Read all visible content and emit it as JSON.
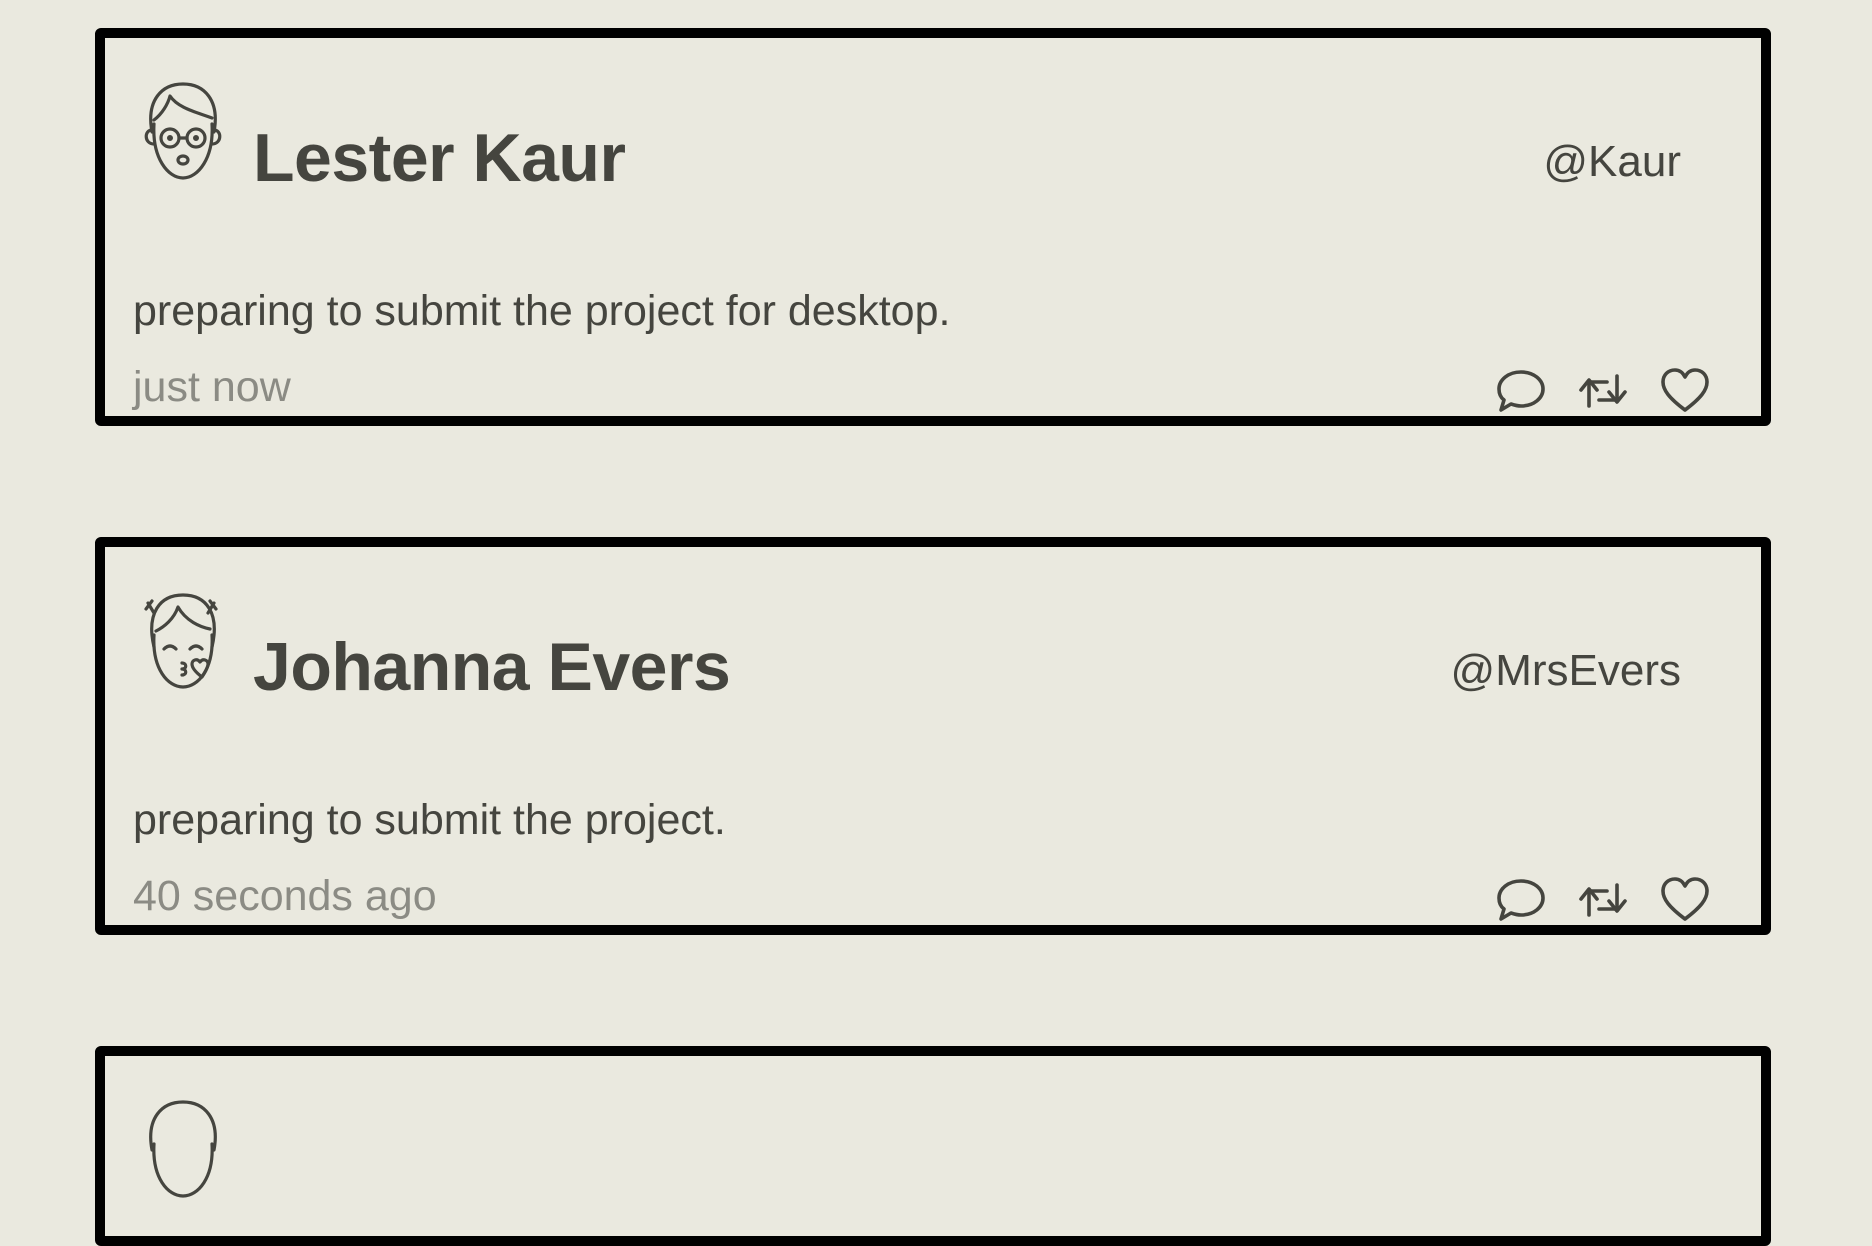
{
  "feed": {
    "posts": [
      {
        "display_name": "Lester Kaur",
        "handle": "@Kaur",
        "text": "preparing to submit the project for desktop.",
        "timestamp": "just now",
        "avatar_icon": "avatar-glasses-icon"
      },
      {
        "display_name": "Johanna Evers",
        "handle": "@MrsEvers",
        "text": "preparing to submit the project.",
        "timestamp": "40 seconds ago",
        "avatar_icon": "avatar-kiss-icon"
      },
      {
        "avatar_icon": "avatar-icon"
      }
    ],
    "actions": {
      "reply_icon": "comment-icon",
      "retweet_icon": "retweet-icon",
      "like_icon": "heart-icon"
    },
    "colors": {
      "background": "#eae9df",
      "text": "#45453f",
      "muted": "#8b8b84",
      "border": "#000000"
    }
  }
}
